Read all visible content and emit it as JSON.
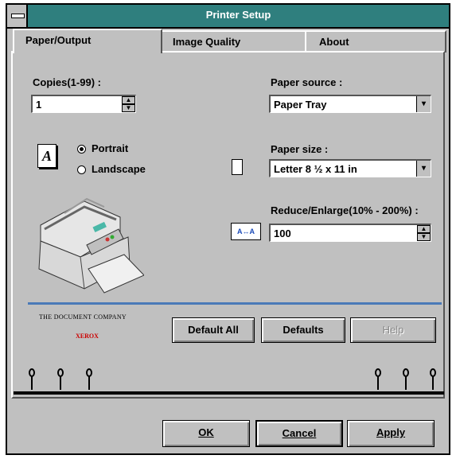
{
  "window": {
    "title": "Printer Setup"
  },
  "tabs": [
    {
      "label": "Paper/Output"
    },
    {
      "label": "Image Quality"
    },
    {
      "label": "About"
    }
  ],
  "copies": {
    "label": "Copies(1-99) :",
    "value": "1"
  },
  "orientation": {
    "portrait_label": "Portrait",
    "landscape_label": "Landscape",
    "selected": "Portrait"
  },
  "paper_source": {
    "label": "Paper source :",
    "value": "Paper Tray"
  },
  "paper_size": {
    "label": "Paper size :",
    "value": "Letter 8 ½ x 11 in"
  },
  "reduce_enlarge": {
    "label": "Reduce/Enlarge(10% - 200%) :",
    "value": "100"
  },
  "branding": {
    "line1": "THE DOCUMENT COMPANY",
    "line2": "XEROX",
    "accent": "#cc0000"
  },
  "panel_buttons": {
    "default_all": "Default All",
    "defaults": "Defaults",
    "help": "Help"
  },
  "dialog_buttons": {
    "ok": "OK",
    "cancel": "Cancel",
    "apply": "Apply"
  },
  "colors": {
    "titlebar": "#2f7f7e",
    "face": "#c0c0c0",
    "divider": "#4a7ab8"
  }
}
